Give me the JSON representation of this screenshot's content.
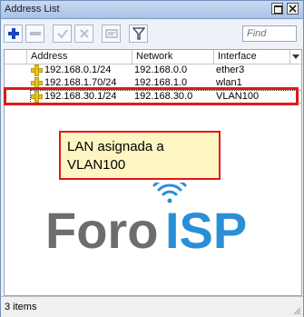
{
  "window": {
    "title": "Address List"
  },
  "toolbar": {
    "find_placeholder": "Find"
  },
  "columns": {
    "address": "Address",
    "network": "Network",
    "interface": "Interface"
  },
  "rows": [
    {
      "address": "192.168.0.1/24",
      "network": "192.168.0.0",
      "interface": "ether3"
    },
    {
      "address": "192.168.1.70/24",
      "network": "192.168.1.0",
      "interface": "wlan1"
    },
    {
      "address": "192.168.30.1/24",
      "network": "192.168.30.0",
      "interface": "VLAN100"
    }
  ],
  "callout": {
    "line1": "LAN asignada a",
    "line2": "VLAN100"
  },
  "logo": {
    "part1": "Foro",
    "part2": "ISP"
  },
  "status": {
    "items": "3 items"
  },
  "colors": {
    "accent_red": "#e01818",
    "callout_bg": "#fdf6c2",
    "logo_gray": "#6d6d6d",
    "logo_blue": "#2a8fd6"
  }
}
